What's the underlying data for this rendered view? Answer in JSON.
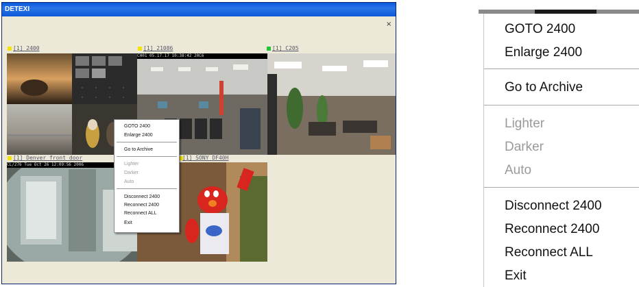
{
  "window": {
    "title": "DETEXI",
    "close_glyph": "×"
  },
  "cameras": [
    {
      "label": "[1] 2400",
      "indicator_color": "#f5e400"
    },
    {
      "label": "[1] 21086",
      "indicator_color": "#f5e400",
      "overlay": "CH01 05.17.17 10:38:42 20C6"
    },
    {
      "label": "[1] C205",
      "indicator_color": "#22c43a"
    },
    {
      "label": "[1] Denver front door",
      "indicator_color": "#f5e400",
      "overlay": "CL/276 Tue Oct 26 12:09:56 2006"
    },
    {
      "label": "[1] SONY DF40H",
      "indicator_color": "#f5e400"
    }
  ],
  "context_menu": {
    "goto": "GOTO 2400",
    "enlarge": "Enlarge 2400",
    "archive": "Go to Archive",
    "lighter": "Lighter",
    "darker": "Darker",
    "auto": "Auto",
    "disconnect": "Disconnect 2400",
    "reconnect": "Reconnect 2400",
    "reconnect_all": "Reconnect ALL",
    "exit": "Exit"
  },
  "colors": {
    "titlebar": "#0a5ade",
    "window_bg": "#ece9d8",
    "disabled_text": "#9a9a9a"
  }
}
